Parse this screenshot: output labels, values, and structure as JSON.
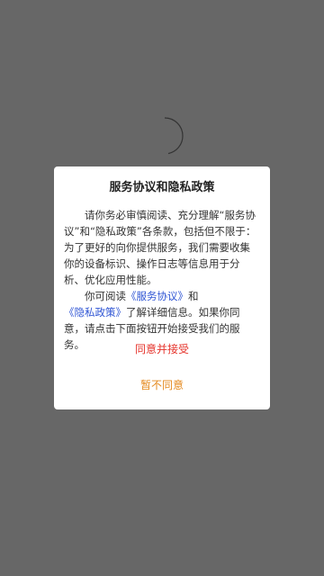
{
  "dialog": {
    "title": "服务协议和隐私政策",
    "paragraph1": "请你务必审慎阅读、充分理解“服务协议”和“隐私政策”各条款，包括但不限于：为了更好的向你提供服务，我们需要收集你的设备标识、操作日志等信息用于分析、优化应用性能。",
    "p2_prefix": "你可阅读",
    "service_link": "《服务协议》",
    "p2_and": "和",
    "privacy_link": "《隐私政策》",
    "p2_suffix": "了解详细信息。如果你同意，请点击下面按钮开始接受我们的服务。",
    "agree_label": "同意并接受",
    "disagree_label": "暂不同意"
  },
  "colors": {
    "overlay": "#676767",
    "link": "#2f55d4",
    "agree": "#e5322a",
    "disagree": "#e4891d"
  },
  "icons": {
    "spinner": "loading-spinner-icon"
  }
}
